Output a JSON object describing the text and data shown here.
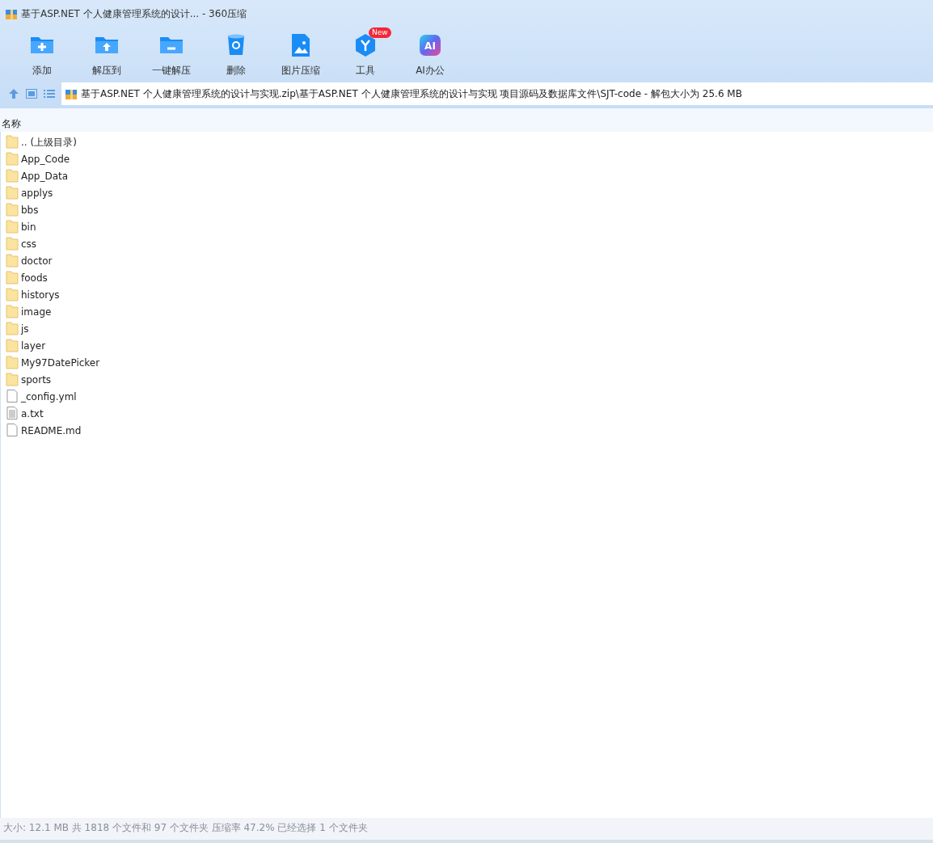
{
  "window": {
    "title": "基于ASP.NET 个人健康管理系统的设计... - 360压缩"
  },
  "toolbar": [
    {
      "kind": "add",
      "label": "添加"
    },
    {
      "kind": "extract",
      "label": "解压到"
    },
    {
      "kind": "oneclick",
      "label": "一键解压"
    },
    {
      "kind": "delete",
      "label": "删除"
    },
    {
      "kind": "image",
      "label": "图片压缩"
    },
    {
      "kind": "tools",
      "label": "工具",
      "badge": "New"
    },
    {
      "kind": "ai",
      "label": "AI办公",
      "icon_text": "AI"
    }
  ],
  "address_bar": {
    "path": "基于ASP.NET 个人健康管理系统的设计与实现.zip\\基于ASP.NET 个人健康管理系统的设计与实现 项目源码及数据库文件\\SJT-code - 解包大小为 25.6 MB"
  },
  "file_list": {
    "columns": [
      "名称"
    ],
    "rows": [
      {
        "kind": "folder",
        "name": ".. (上级目录)"
      },
      {
        "kind": "folder",
        "name": "App_Code"
      },
      {
        "kind": "folder",
        "name": "App_Data"
      },
      {
        "kind": "folder",
        "name": "applys"
      },
      {
        "kind": "folder",
        "name": "bbs"
      },
      {
        "kind": "folder",
        "name": "bin"
      },
      {
        "kind": "folder",
        "name": "css"
      },
      {
        "kind": "folder",
        "name": "doctor"
      },
      {
        "kind": "folder",
        "name": "foods"
      },
      {
        "kind": "folder",
        "name": "historys"
      },
      {
        "kind": "folder",
        "name": "image"
      },
      {
        "kind": "folder",
        "name": "js"
      },
      {
        "kind": "folder",
        "name": "layer"
      },
      {
        "kind": "folder",
        "name": "My97DatePicker"
      },
      {
        "kind": "folder",
        "name": "sports"
      },
      {
        "kind": "file",
        "name": "_config.yml"
      },
      {
        "kind": "text",
        "name": "a.txt"
      },
      {
        "kind": "file",
        "name": "README.md"
      }
    ]
  },
  "status_bar": {
    "text": "大小: 12.1 MB 共 1818 个文件和 97 个文件夹 压缩率 47.2% 已经选择 1 个文件夹"
  }
}
